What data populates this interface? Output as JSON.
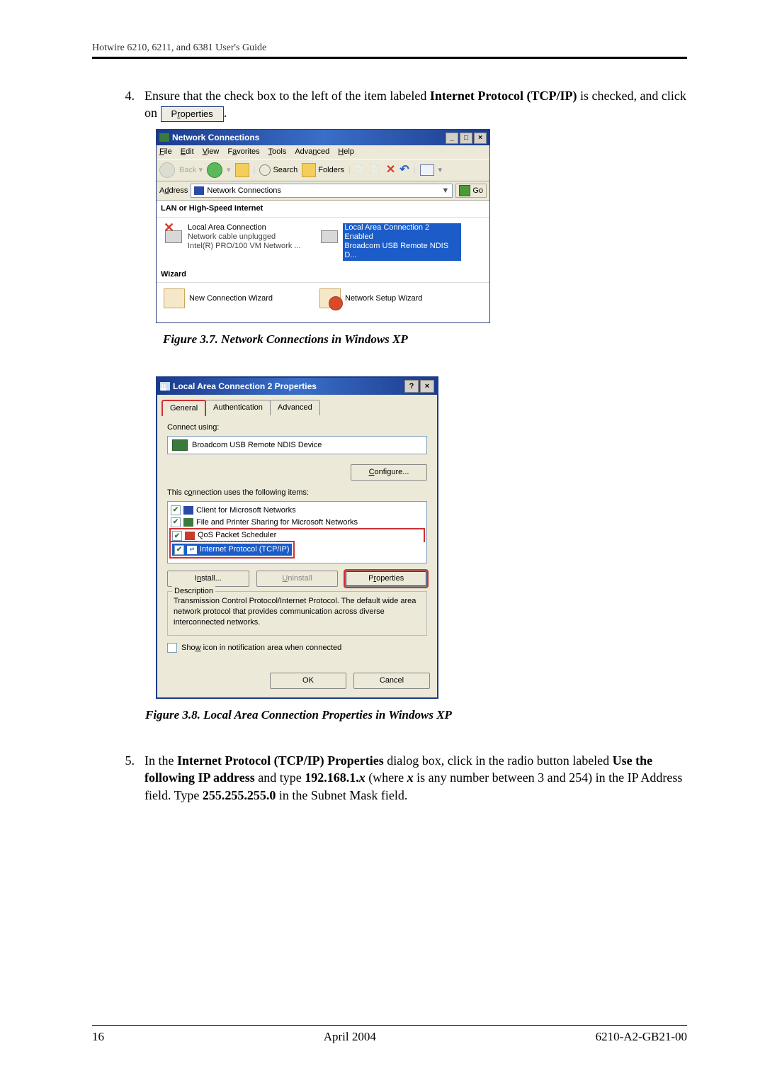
{
  "header": "Hotwire 6210, 6211, and 6381 User's Guide",
  "step4": {
    "num": "4.",
    "text_a": "Ensure that the check box to the left of the item labeled ",
    "bold_a": "Internet Protocol (TCP/IP)",
    "text_b": " is checked, and click on ",
    "btn_pre": "P",
    "btn_u": "r",
    "btn_post": "operties",
    "text_c": "."
  },
  "explorer": {
    "title": "Network Connections",
    "min": "_",
    "max": "□",
    "close": "×",
    "menu": {
      "file": "File",
      "edit": "Edit",
      "view": "View",
      "fav": "Favorites",
      "tools": "Tools",
      "adv": "Advanced",
      "help": "Help"
    },
    "menu_u": {
      "file": "F",
      "edit": "E",
      "view": "V",
      "fav": "a",
      "tools": "T",
      "adv": "n",
      "help": "H"
    },
    "menu_rest": {
      "file": "ile",
      "edit": "dit",
      "view": "iew",
      "fav": "vorites",
      "tools": "ools",
      "adv": "ced",
      "help": "elp"
    },
    "menu_pre": {
      "fav": "F",
      "adv": "Adva"
    },
    "search": "Search",
    "folders": "Folders",
    "addr_label": "Address",
    "addr_u": "d",
    "addr_rest": "dress",
    "addr_pre": "A",
    "addr_value": "Network Connections",
    "go": "Go",
    "sect1": "LAN or High-Speed Internet",
    "conn1": {
      "l1": "Local Area Connection",
      "l2": "Network cable unplugged",
      "l3": "Intel(R) PRO/100 VM Network ..."
    },
    "conn2": {
      "l1": "Local Area Connection 2",
      "l2": "Enabled",
      "l3": "Broadcom USB Remote NDIS D..."
    },
    "sect2": "Wizard",
    "wiz1": "New Connection Wizard",
    "wiz2": "Network Setup Wizard"
  },
  "fig7": "Figure 3.7. Network Connections in Windows XP",
  "dialog": {
    "title": "Local Area Connection 2 Properties",
    "help": "?",
    "close": "×",
    "tabs": {
      "general": "General",
      "auth": "Authentication",
      "adv": "Advanced"
    },
    "connect_using": "Connect using:",
    "adapter": "Broadcom USB Remote NDIS Device",
    "configure": "Configure...",
    "conf_u": "C",
    "conf_rest": "onfigure...",
    "uses": "This connection uses the following items:",
    "uses_u": "o",
    "uses_pre": "This c",
    "uses_rest": "nnection uses the following items:",
    "item1": "Client for Microsoft Networks",
    "item2": "File and Printer Sharing for Microsoft Networks",
    "item3": "QoS Packet Scheduler",
    "item4": "Internet Protocol (TCP/IP)",
    "install": "Install...",
    "install_u": "n",
    "install_pre": "I",
    "install_rest": "stall...",
    "uninstall": "Uninstall",
    "uninstall_u": "U",
    "uninstall_rest": "ninstall",
    "properties": "Properties",
    "prop_u": "r",
    "prop_pre": "P",
    "prop_rest": "operties",
    "desc_label": "Description",
    "desc": "Transmission Control Protocol/Internet Protocol. The default wide area network protocol that provides communication across diverse interconnected networks.",
    "show_icon": "Show icon in notification area when connected",
    "show_u": "w",
    "show_pre": "Sho",
    "show_rest": " icon in notification area when connected",
    "ok": "OK",
    "cancel": "Cancel"
  },
  "fig8": "Figure 3.8. Local Area Connection Properties in Windows XP",
  "step5": {
    "num": "5.",
    "t1": "In the ",
    "b1": "Internet Protocol (TCP/IP) Properties",
    "t2": " dialog box, click in the radio button labeled ",
    "b2": "Use the following IP address",
    "t3": " and type ",
    "b3": "192.168.1.",
    "bi": "x",
    "t4": " (where ",
    "bi2": "x",
    "t5": " is any number between 3 and 254) in the IP Address field. Type ",
    "b4": "255.255.255.0",
    "t6": " in the Subnet Mask field."
  },
  "footer": {
    "page": "16",
    "date": "April 2004",
    "doc": "6210-A2-GB21-00"
  }
}
